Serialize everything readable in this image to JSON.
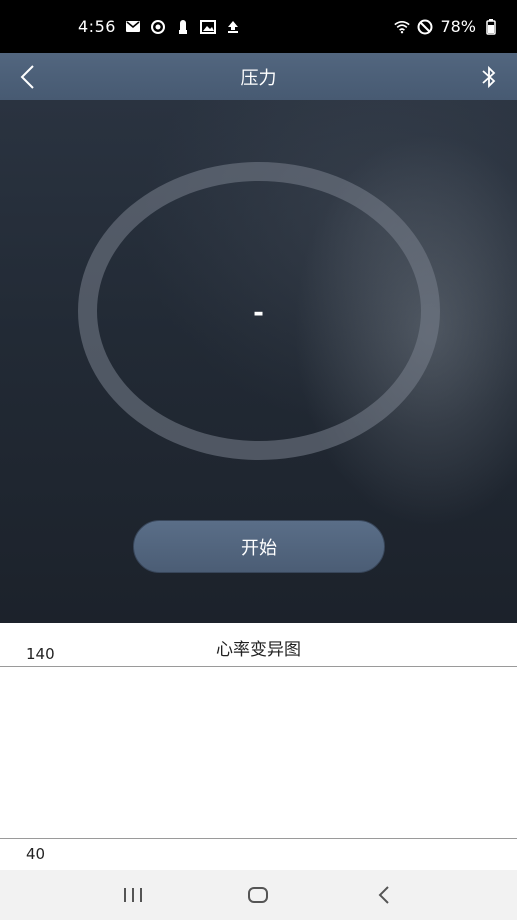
{
  "status_bar": {
    "time": "4:56",
    "battery": "78%",
    "left_icons": [
      "gmail-icon",
      "sync-icon",
      "notification-icon",
      "image-icon",
      "upload-icon"
    ],
    "right_icons": [
      "wifi-icon",
      "do-not-disturb-icon",
      "battery-icon"
    ]
  },
  "app_bar": {
    "title": "压力",
    "back_icon": "chevron-left-icon",
    "action_icon": "bluetooth-icon"
  },
  "measure": {
    "value": "-",
    "start_label": "开始"
  },
  "chart_data": {
    "type": "line",
    "title": "心率变异图",
    "ylim": [
      40,
      140
    ],
    "y_ticks": [
      "140",
      "40"
    ],
    "series": []
  },
  "nav_bar": {
    "buttons": [
      "recents-icon",
      "home-icon",
      "back-icon"
    ]
  },
  "colors": {
    "app_bar": "#4d6079",
    "hero_bg": "#222a35",
    "ring": "#6f7784",
    "button": "#52657e"
  }
}
